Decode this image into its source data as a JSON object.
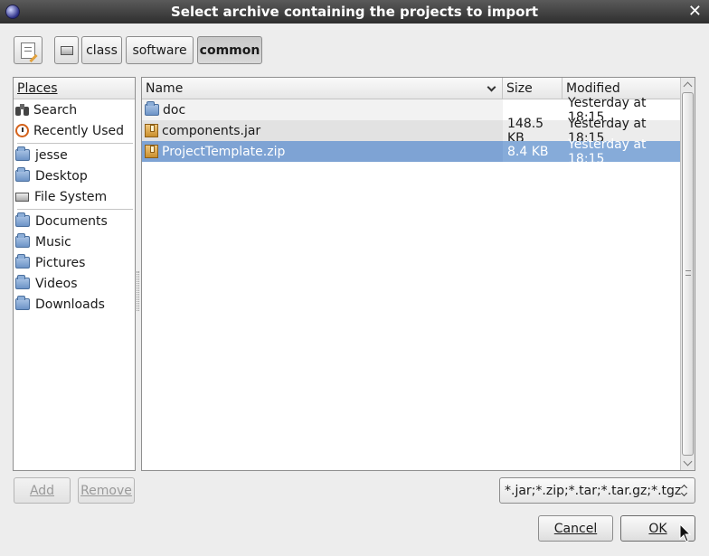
{
  "window": {
    "title": "Select archive containing the projects to import"
  },
  "path_bar": {
    "segments": [
      "class",
      "software",
      "common"
    ],
    "active": "common"
  },
  "places": {
    "header": "Places",
    "items": [
      "Search",
      "Recently Used",
      "jesse",
      "Desktop",
      "File System",
      "Documents",
      "Music",
      "Pictures",
      "Videos",
      "Downloads"
    ]
  },
  "columns": {
    "name": "Name",
    "size": "Size",
    "modified": "Modified"
  },
  "files": [
    {
      "name": "doc",
      "size": "",
      "modified": "Yesterday at 18:15",
      "icon": "folder-icon"
    },
    {
      "name": "components.jar",
      "size": "148.5 KB",
      "modified": "Yesterday at 18:15",
      "icon": "archive-icon"
    },
    {
      "name": "ProjectTemplate.zip",
      "size": "8.4 KB",
      "modified": "Yesterday at 18:15",
      "icon": "archive-icon",
      "selected": true
    }
  ],
  "buttons": {
    "add": "Add",
    "remove": "Remove",
    "cancel": "Cancel",
    "ok": "OK"
  },
  "filter": {
    "value": "*.jar;*.zip;*.tar;*.tar.gz;*.tgz"
  },
  "colors": {
    "selection": "#86abd9",
    "titlebar": "#3a3a3a"
  }
}
